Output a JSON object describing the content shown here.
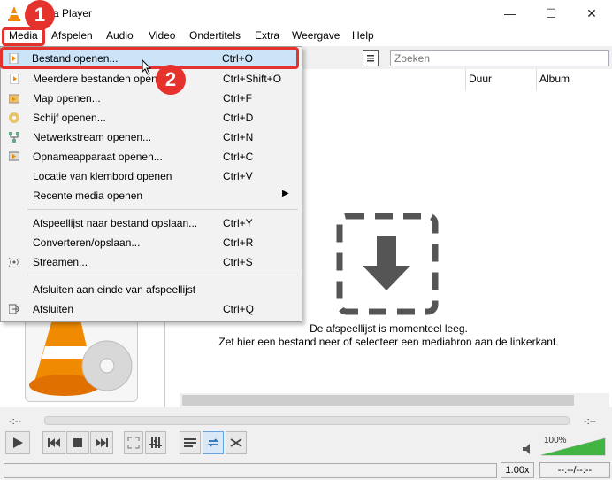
{
  "window": {
    "title": "VLC media player",
    "title_visible": "edia Player"
  },
  "menubar": [
    "Media",
    "Afspelen",
    "Audio",
    "Video",
    "Ondertitels",
    "Extra",
    "Weergave",
    "Help"
  ],
  "search": {
    "placeholder": "Zoeken"
  },
  "playlist": {
    "columns": [
      "Duur",
      "Album"
    ],
    "empty_line1": "De afspeellijst is momenteel leeg.",
    "empty_line2": "Zet hier een bestand neer of selecteer een mediabron aan de linkerkant."
  },
  "media_menu": {
    "items": [
      {
        "label": "Bestand openen...",
        "shortcut": "Ctrl+O",
        "icon": "file-icon"
      },
      {
        "label": "Meerdere bestanden openen...",
        "shortcut": "Ctrl+Shift+O",
        "icon": "files-icon"
      },
      {
        "label": "Map openen...",
        "shortcut": "Ctrl+F",
        "icon": "folder-icon"
      },
      {
        "label": "Schijf openen...",
        "shortcut": "Ctrl+D",
        "icon": "disc-icon"
      },
      {
        "label": "Netwerkstream openen...",
        "shortcut": "Ctrl+N",
        "icon": "network-icon"
      },
      {
        "label": "Opnameapparaat openen...",
        "shortcut": "Ctrl+C",
        "icon": "capture-icon"
      },
      {
        "label": "Locatie van klembord openen",
        "shortcut": "Ctrl+V",
        "icon": ""
      },
      {
        "label": "Recente media openen",
        "shortcut": "",
        "icon": ""
      },
      {
        "label": "Afspeellijst naar bestand opslaan...",
        "shortcut": "Ctrl+Y",
        "icon": ""
      },
      {
        "label": "Converteren/opslaan...",
        "shortcut": "Ctrl+R",
        "icon": ""
      },
      {
        "label": "Streamen...",
        "shortcut": "Ctrl+S",
        "icon": "stream-icon"
      },
      {
        "label": "Afsluiten aan einde van afspeellijst",
        "shortcut": "",
        "icon": ""
      },
      {
        "label": "Afsluiten",
        "shortcut": "Ctrl+Q",
        "icon": "exit-icon"
      }
    ]
  },
  "callouts": [
    "1",
    "2"
  ],
  "player": {
    "time_elapsed": "-:--",
    "time_remaining": "-:--",
    "volume": "100%",
    "speed": "1.00x",
    "duration": "--:--/--:--"
  },
  "colors": {
    "accent_red": "#e5322d",
    "highlight": "#cce4f7",
    "vlc_orange": "#f08a00"
  }
}
